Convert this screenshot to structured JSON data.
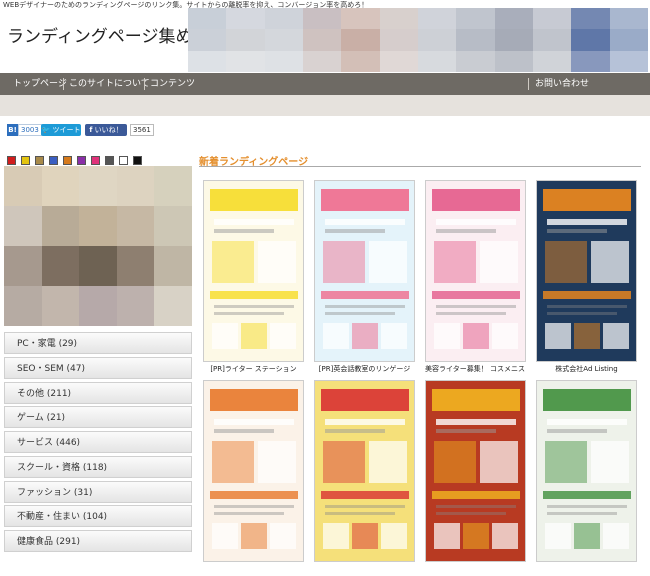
{
  "header": {
    "tagline": "WEBデザイナーのためのランディングページのリンク集。サイトからの離脱率を抑え、コンバージョン率を高めろ！",
    "logo": "ランディングページ集めました。",
    "mosaic_colors": [
      "#c8cfd8",
      "#d5d8df",
      "#cfd3da",
      "#c9bfc2",
      "#d7c4bd",
      "#d8d0cd",
      "#d0d3da",
      "#c0c5ce",
      "#a9aebb",
      "#c7cad3",
      "#7488b2",
      "#a9b7cf",
      "#cbd0d8",
      "#d2d4d8",
      "#d4d7dc",
      "#cfc2c0",
      "#c9afa6",
      "#d6cdcc",
      "#cdd0d6",
      "#b7bcc6",
      "#a6abb7",
      "#c0c4cc",
      "#5f77a8",
      "#9aabc8",
      "#dde1e6",
      "#e1e3e6",
      "#dee1e5",
      "#d9d2d1",
      "#d3bfb7",
      "#e0d8d6",
      "#d7dade",
      "#c9ccd2",
      "#bdc1c9",
      "#d0d3d8",
      "#8898bd",
      "#b6c2d8"
    ]
  },
  "nav": {
    "items": [
      "トップページ",
      "このサイトについて",
      "コンテンツ"
    ],
    "contact": "お問い合わせ"
  },
  "social": {
    "hatena_label": "B!",
    "hatena_count": "3003",
    "tweet": "ツイート",
    "fb_like": "いいね！",
    "fb_count": "3561"
  },
  "swatch_colors": [
    "#d11d1d",
    "#e3c410",
    "#a88a4a",
    "#3b5ec1",
    "#d67a1c",
    "#8a2fa8",
    "#e0327a",
    "#555555",
    "#ffffff",
    "#111111"
  ],
  "sidebar_mosaic": [
    "#d8cbb5",
    "#e0d4bd",
    "#dfd6c3",
    "#ddd3c0",
    "#d6d1bd",
    "#cfc6bb",
    "#b8ab97",
    "#c2b299",
    "#c6b8a4",
    "#cdc7b5",
    "#a6998e",
    "#7d6e60",
    "#6e6253",
    "#8e7f70",
    "#bfb6a5",
    "#b6aba3",
    "#c2b6ac",
    "#b6a9a9",
    "#bdb1ad",
    "#d8d2c6"
  ],
  "categories": [
    "PC・家電 (29)",
    "SEO・SEM (47)",
    "その他 (211)",
    "ゲーム (21)",
    "サービス (446)",
    "スクール・資格 (118)",
    "ファッション (31)",
    "不動産・住まい (104)",
    "健康食品 (291)"
  ],
  "section_title": "新着ランディングページ",
  "cards": [
    {
      "caption": "[PR]ライター ステーション",
      "accent": "#f6dc27",
      "bg": "#fdf9e6"
    },
    {
      "caption": "[PR]英会話教室のリンゲージ",
      "accent": "#ef6a8c",
      "bg": "#e4f3fa"
    },
    {
      "caption": "美容ライター募集！ コスメニスト",
      "accent": "#e45a8a",
      "bg": "#fbeef2"
    },
    {
      "caption": "株式会社Ad Listing",
      "accent": "#f08a1c",
      "bg": "#1f3a5c"
    },
    {
      "caption": "",
      "accent": "#e8782a",
      "bg": "#fbf2e8"
    },
    {
      "caption": "",
      "accent": "#d93232",
      "bg": "#f5e07a"
    },
    {
      "caption": "",
      "accent": "#f2b520",
      "bg": "#b83a22"
    },
    {
      "caption": "",
      "accent": "#3f8f3c",
      "bg": "#eef2ea"
    }
  ]
}
